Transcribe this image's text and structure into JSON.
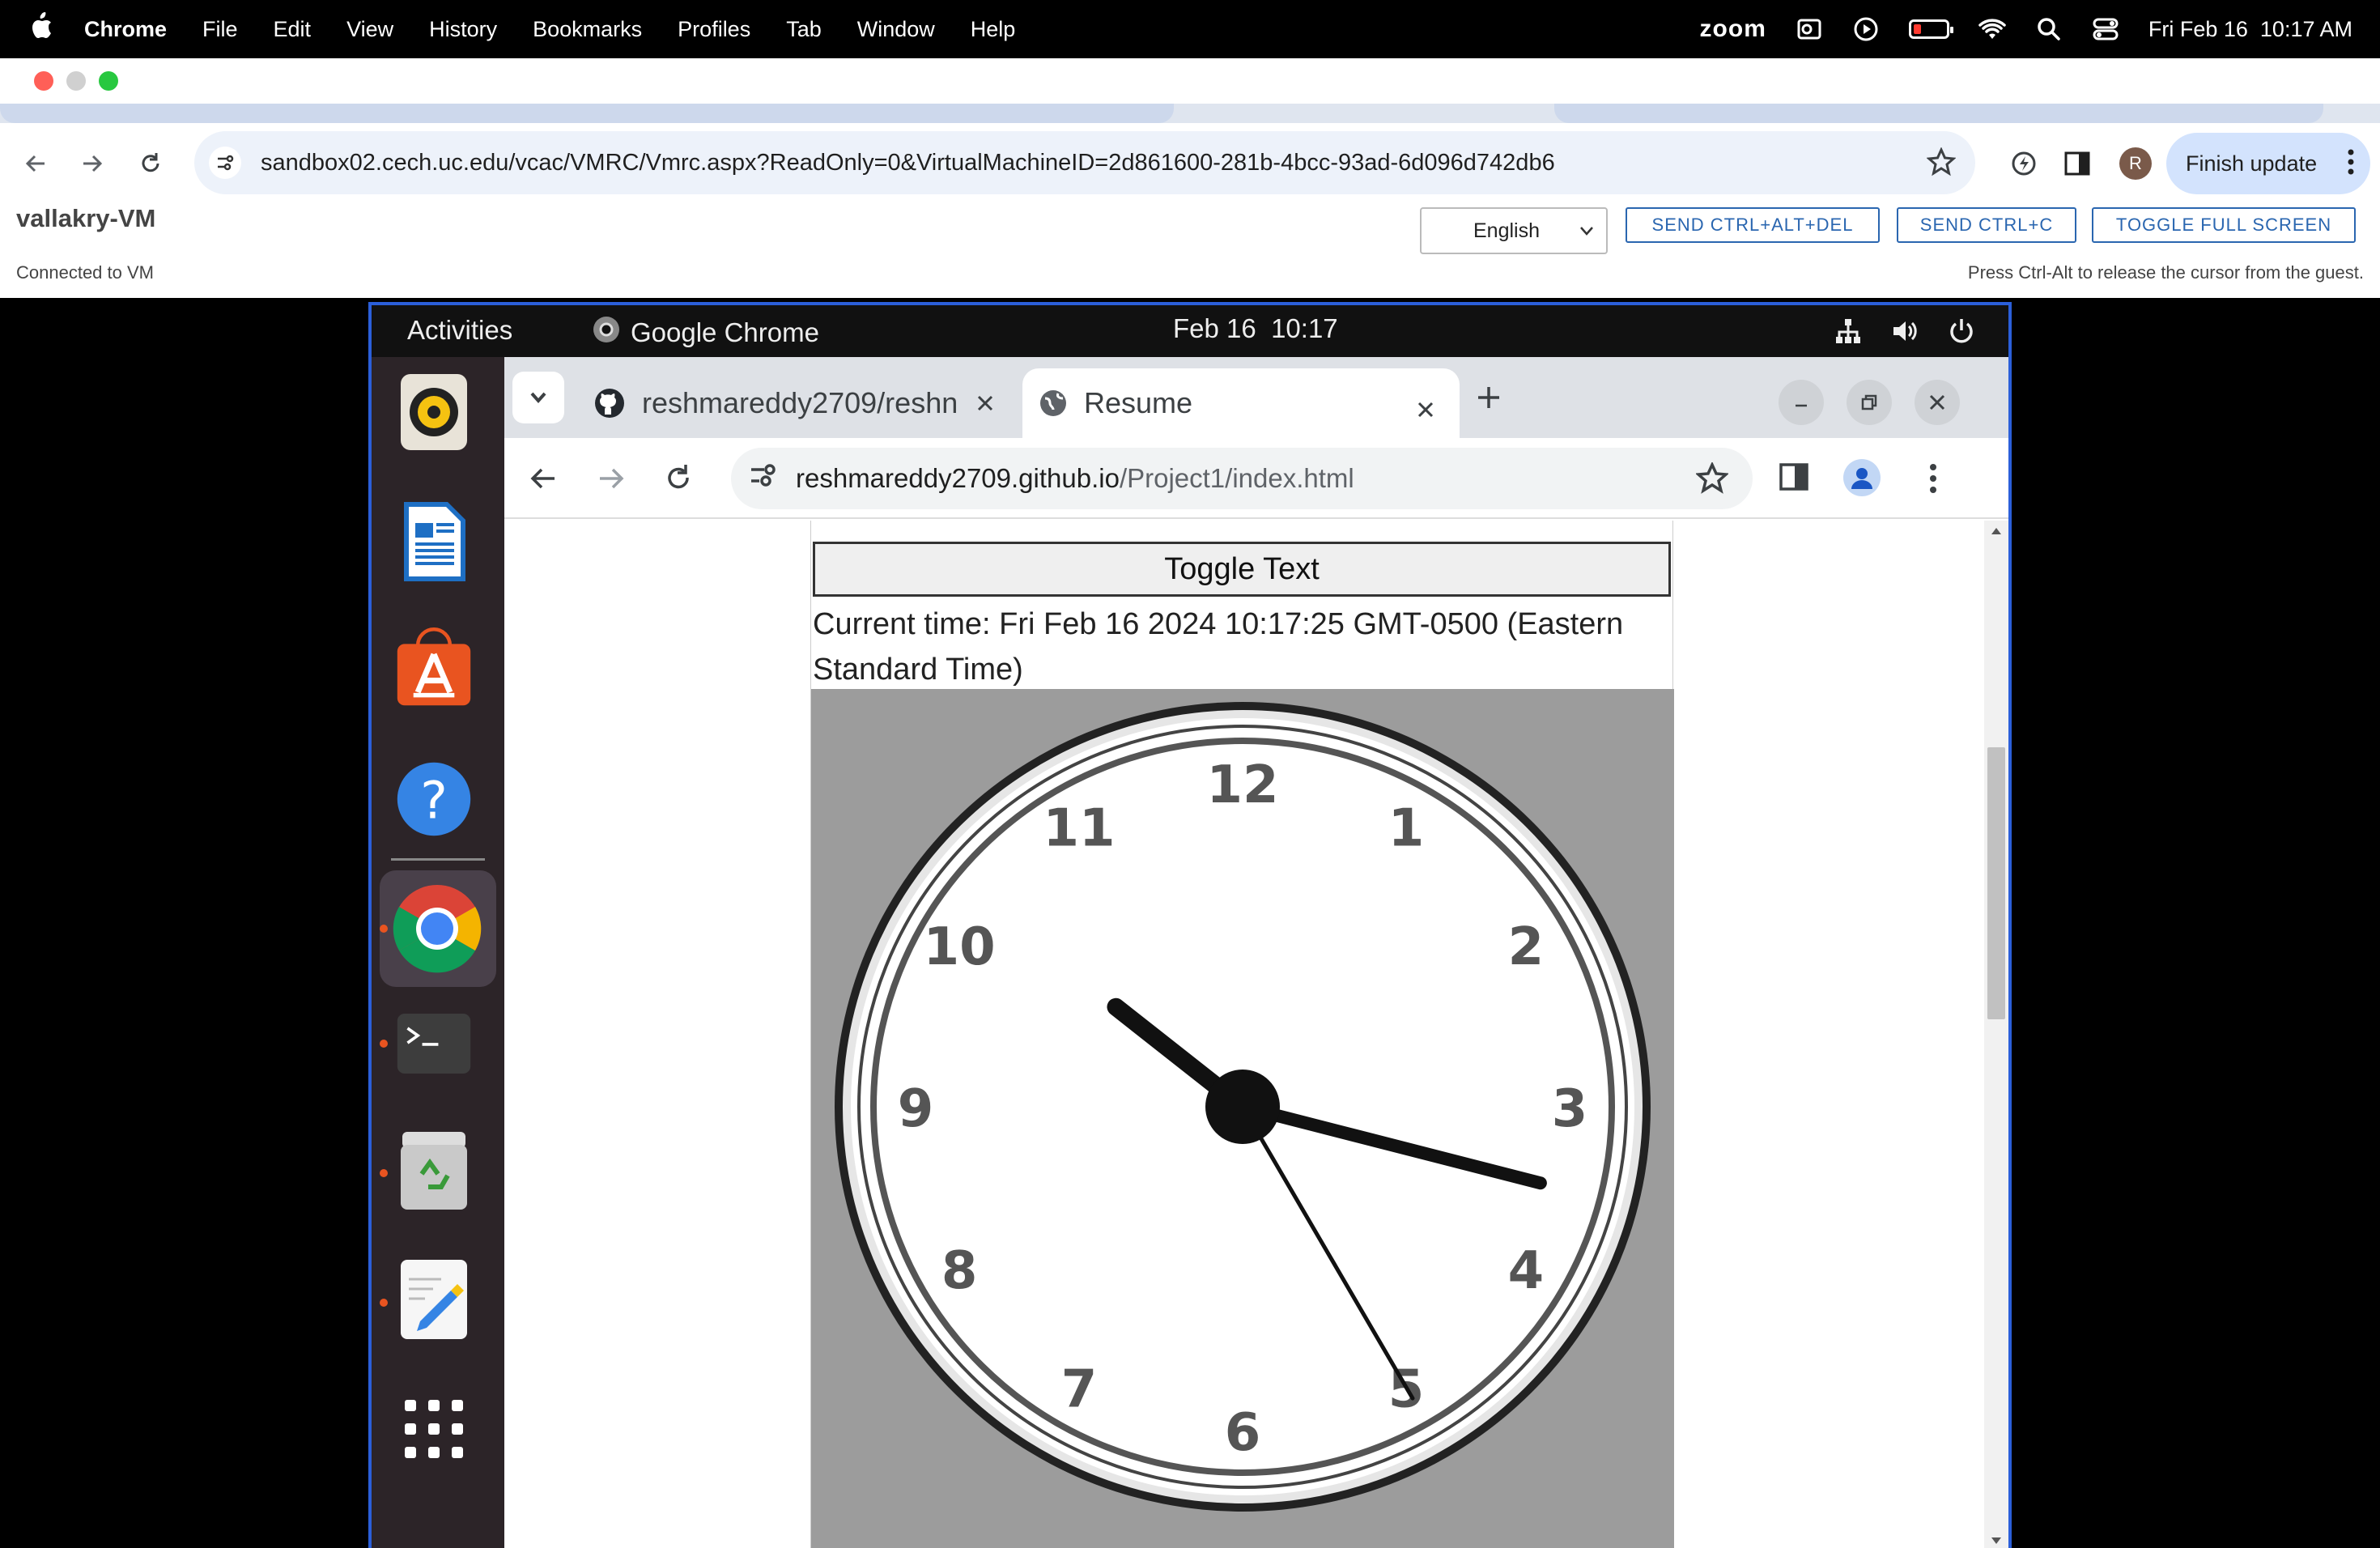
{
  "mac_menubar": {
    "app_name": "Chrome",
    "menus": [
      "File",
      "Edit",
      "View",
      "History",
      "Bookmarks",
      "Profiles",
      "Tab",
      "Window",
      "Help"
    ],
    "zoom_label": "zoom",
    "datetime": "Fri Feb 16  10:17 AM",
    "battery_level": 0.1
  },
  "host_browser": {
    "url": "sandbox02.cech.uc.edu/vcac/VMRC/Vmrc.aspx?ReadOnly=0&VirtualMachineID=2d861600-281b-4bcc-93ad-6d096d742db6",
    "finish_update_label": "Finish update",
    "profile_initial": "R"
  },
  "vmrc": {
    "vm_name": "vallakry-VM",
    "status": "Connected to VM",
    "hint": "Press Ctrl-Alt to release the cursor from the guest.",
    "language": "English",
    "buttons": {
      "ctrl_alt_del": "SEND CTRL+ALT+DEL",
      "ctrl_c": "SEND CTRL+C",
      "fullscreen": "TOGGLE FULL SCREEN"
    }
  },
  "guest": {
    "topbar": {
      "activities": "Activities",
      "app": "Google Chrome",
      "clock": "Feb 16  10:17"
    },
    "dock": [
      "rhythmbox-icon",
      "writer-icon",
      "software-icon",
      "help-icon",
      "chrome-icon",
      "terminal-icon",
      "trash-icon",
      "text-editor-icon",
      "show-apps-icon"
    ],
    "browser": {
      "tabs": [
        {
          "title": "reshmareddy2709/reshn",
          "active": false
        },
        {
          "title": "Resume",
          "active": true
        }
      ],
      "url_host": "reshmareddy2709.github.io",
      "url_path": "/Project1/index.html"
    },
    "page": {
      "toggle_button": "Toggle Text",
      "time_text": "Current time: Fri Feb 16 2024 10:17:25 GMT-0500 (Eastern Standard Time)",
      "clock": {
        "numerals": [
          "12",
          "1",
          "2",
          "3",
          "4",
          "5",
          "6",
          "7",
          "8",
          "9",
          "10",
          "11"
        ],
        "hour": 10,
        "minute": 17,
        "second": 25
      }
    }
  }
}
